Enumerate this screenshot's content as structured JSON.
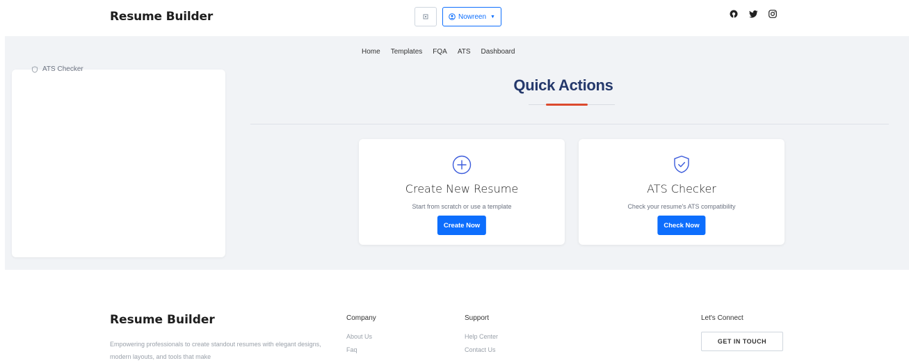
{
  "header": {
    "brand": "Resume Builder",
    "user_label": "Nowreen",
    "socials": [
      "github-icon",
      "twitter-icon",
      "instagram-icon"
    ]
  },
  "nav": {
    "items": [
      "Home",
      "Templates",
      "FQA",
      "ATS",
      "Dashboard"
    ]
  },
  "sidebar": {
    "items": [
      {
        "label": "ATS Checker",
        "icon": "shield-icon"
      }
    ]
  },
  "quick_actions": {
    "title": "Quick Actions",
    "accent": "#dc4a2e",
    "cards": [
      {
        "icon": "plus-circle-icon",
        "title": "Create New Resume",
        "description": "Start from scratch or use a template",
        "button": "Create Now"
      },
      {
        "icon": "shield-check-icon",
        "title": "ATS Checker",
        "description": "Check your resume's ATS compatibility",
        "button": "Check Now"
      }
    ]
  },
  "footer": {
    "brand": "Resume Builder",
    "description": "Empowering professionals to create standout resumes with elegant designs, modern layouts, and tools that make",
    "company": {
      "heading": "Company",
      "links": [
        "About Us",
        "Faq"
      ]
    },
    "support": {
      "heading": "Support",
      "links": [
        "Help Center",
        "Contact Us"
      ]
    },
    "connect": {
      "heading": "Let's Connect",
      "button": "GET IN TOUCH"
    }
  },
  "colors": {
    "primary": "#0d6efd",
    "title": "#24386b",
    "background": "#f1f3f6"
  }
}
